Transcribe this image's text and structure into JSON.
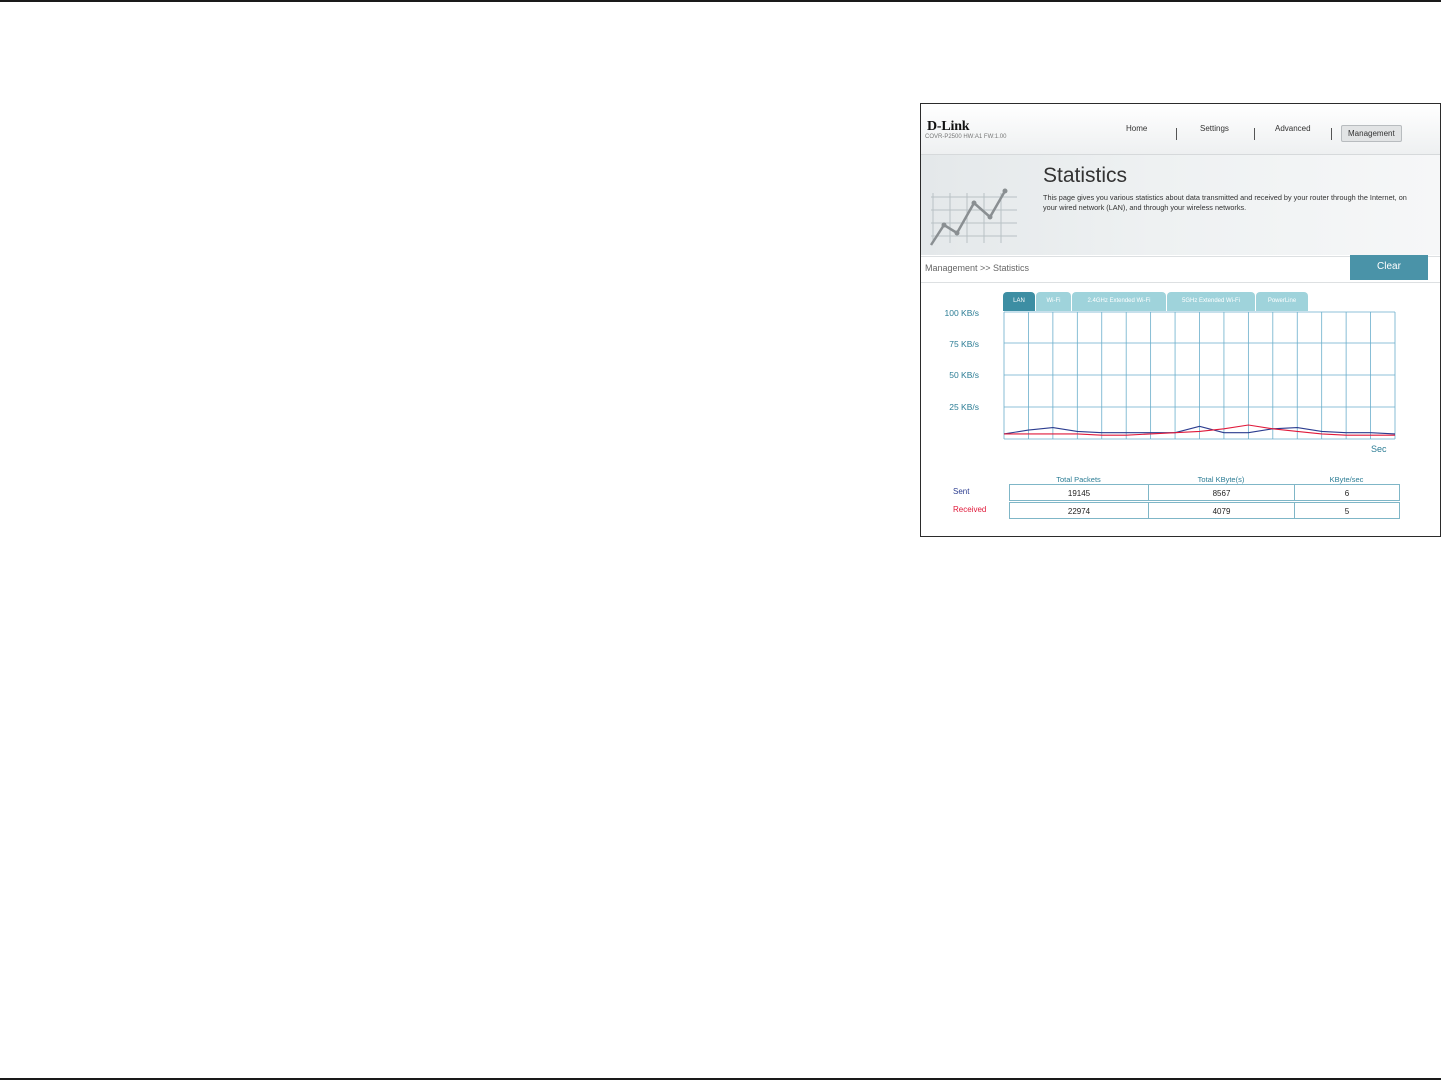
{
  "header": {
    "logo": "D-Link",
    "model_line": "COVR-P2500   HW:A1   FW:1.00",
    "nav": [
      "Home",
      "Settings",
      "Advanced",
      "Management"
    ]
  },
  "banner": {
    "title": "Statistics",
    "description": "This page gives you various statistics about data transmitted and received by your router through the Internet, on your wired network (LAN), and through your wireless networks."
  },
  "breadcrumb": "Management >> Statistics",
  "clear_label": "Clear",
  "tabs": [
    "LAN",
    "Wi-Fi",
    "2.4GHz Extended Wi-Fi",
    "5GHz Extended Wi-Fi",
    "PowerLine"
  ],
  "colors": {
    "accent": "#4a93a8",
    "sent": "#2b3c8f",
    "received": "#e0193a",
    "grid": "#6aaecb"
  },
  "chart_data": {
    "type": "line",
    "y_ticks": [
      "100 KB/s",
      "75 KB/s",
      "50 KB/s",
      "25 KB/s"
    ],
    "x_unit": "Sec",
    "ylim": [
      0,
      100
    ],
    "series": [
      {
        "name": "Sent",
        "values": [
          4,
          7,
          9,
          6,
          5,
          5,
          5,
          5,
          10,
          5,
          5,
          8,
          9,
          6,
          5,
          5,
          4
        ]
      },
      {
        "name": "Received",
        "values": [
          4,
          4,
          4,
          4,
          3,
          3,
          4,
          5,
          6,
          8,
          11,
          8,
          6,
          4,
          3,
          3,
          3
        ]
      }
    ]
  },
  "table": {
    "columns": [
      "Total Packets",
      "Total KByte(s)",
      "KByte/sec"
    ],
    "rows": [
      {
        "label": "Sent",
        "values": [
          "19145",
          "8567",
          "6"
        ]
      },
      {
        "label": "Received",
        "values": [
          "22974",
          "4079",
          "5"
        ]
      }
    ]
  }
}
